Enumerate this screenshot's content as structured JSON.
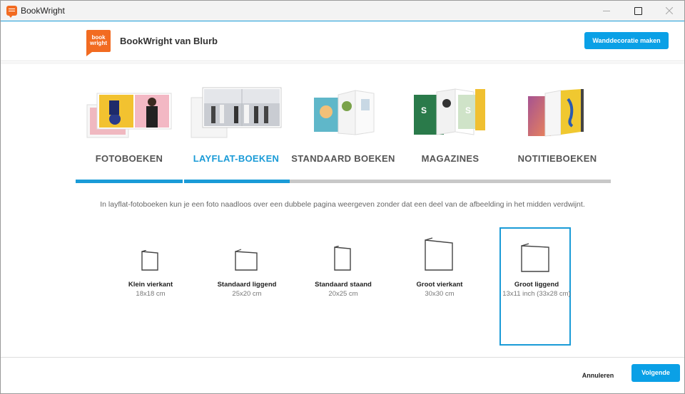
{
  "window": {
    "title": "BookWright"
  },
  "header": {
    "logo_text": "book wright",
    "brand": "BookWright van Blurb",
    "wall_button": "Wanddecoratie maken"
  },
  "categories": [
    {
      "label": "FOTOBOEKEN",
      "active": false
    },
    {
      "label": "LAYFLAT-BOEKEN",
      "active": true
    },
    {
      "label": "STANDAARD BOEKEN",
      "active": false
    },
    {
      "label": "MAGAZINES",
      "active": false
    },
    {
      "label": "NOTITIEBOEKEN",
      "active": false
    }
  ],
  "progress": {
    "filled_fraction": 0.4
  },
  "description": "In layflat-fotoboeken kun je een foto naadloos over een dubbele pagina weergeven zonder dat een deel van de afbeelding in het midden verdwijnt.",
  "sizes": [
    {
      "name": "Klein vierkant",
      "dims": "18x18 cm",
      "selected": false
    },
    {
      "name": "Standaard liggend",
      "dims": "25x20 cm",
      "selected": false
    },
    {
      "name": "Standaard staand",
      "dims": "20x25 cm",
      "selected": false
    },
    {
      "name": "Groot vierkant",
      "dims": "30x30 cm",
      "selected": false
    },
    {
      "name": "Groot liggend",
      "dims": "13x11 inch (33x28 cm)",
      "selected": true
    }
  ],
  "footer": {
    "cancel": "Annuleren",
    "next": "Volgende"
  },
  "colors": {
    "accent": "#0aa0e6",
    "brand": "#f26b21"
  }
}
